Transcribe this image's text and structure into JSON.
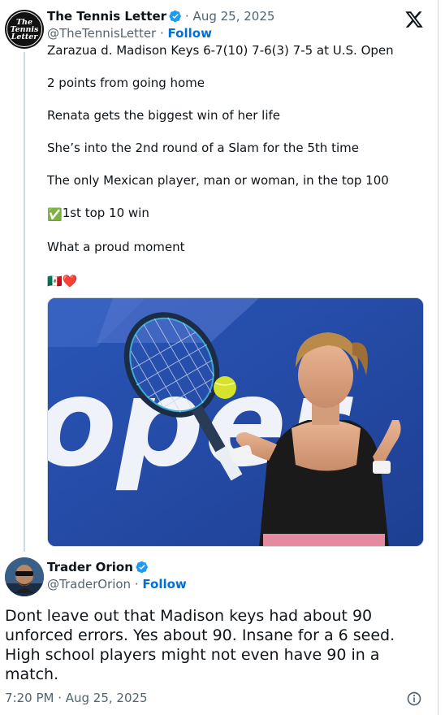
{
  "tweet": {
    "author_name": "The Tennis Letter",
    "date": "· Aug 25, 2025",
    "handle": "@TheTennisLetter",
    "follow_label": "Follow",
    "avatar_text": [
      "The",
      "Tennis",
      "Letter"
    ],
    "lines": [
      "Zarazua d. Madison Keys 6-7(10) 7-6(3) 7-5 at U.S. Open",
      "2 points from going home",
      "Renata gets the biggest win of her life",
      "She’s into the 2nd round of a Slam for the 5th time",
      "The only Mexican player, man or woman, in the top 100",
      "1st top 10 win",
      "What a proud moment"
    ],
    "media_text": "oper",
    "emojis": {
      "check": "✅",
      "flag_heart": "🇲🇽❤️"
    }
  },
  "reply": {
    "author_name": "Trader Orion",
    "handle": "@TraderOrion",
    "follow_label": "Follow",
    "text": "Dont leave out that Madison keys had about 90 unforced errors. Yes about 90. Insane for a 6 seed. High school players might not even have 90 in a match.",
    "timestamp": "7:20 PM · Aug 25, 2025"
  },
  "icons": {
    "verified": "verified-badge-icon",
    "x_logo": "x-logo-icon",
    "info": "info-icon"
  },
  "colors": {
    "link_blue": "#006fd6",
    "verified_blue": "#1d9bf0",
    "muted": "#536471"
  }
}
